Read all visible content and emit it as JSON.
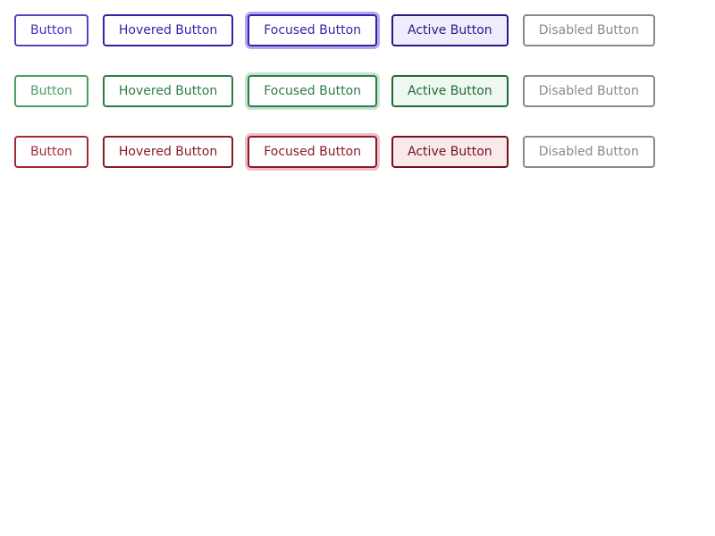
{
  "rows": [
    {
      "variant": "purple",
      "accent": "#4a2fb8",
      "buttons": {
        "normal": "Button",
        "hovered": "Hovered Button",
        "focused": "Focused Button",
        "active": "Active Button",
        "disabled": "Disabled Button"
      }
    },
    {
      "variant": "green",
      "accent": "#2f7a45",
      "buttons": {
        "normal": "Button",
        "hovered": "Hovered Button",
        "focused": "Focused Button",
        "active": "Active Button",
        "disabled": "Disabled Button"
      }
    },
    {
      "variant": "red",
      "accent": "#8a1a24",
      "buttons": {
        "normal": "Button",
        "hovered": "Hovered Button",
        "focused": "Focused Button",
        "active": "Active Button",
        "disabled": "Disabled Button"
      }
    }
  ],
  "colors": {
    "disabled": "#8a8a8a",
    "background": "#ffffff"
  }
}
